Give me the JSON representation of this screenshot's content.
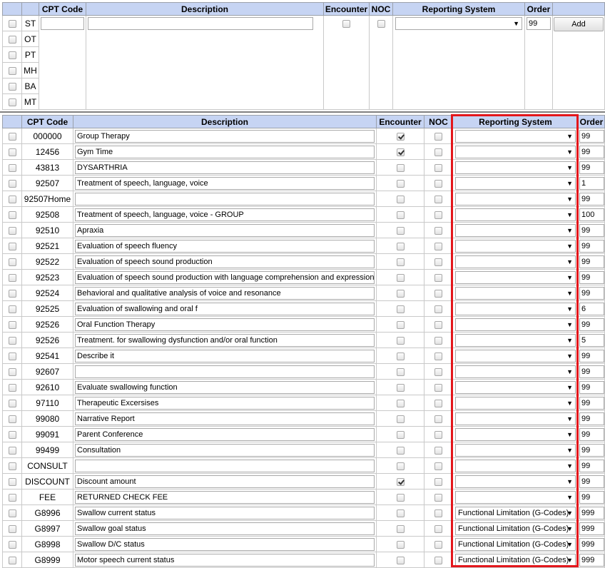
{
  "headers": {
    "cpt_code": "CPT Code",
    "description": "Description",
    "encounter": "Encounter",
    "noc": "NOC",
    "reporting_system": "Reporting System",
    "order": "Order"
  },
  "new_entry": {
    "disciplines": [
      "ST",
      "OT",
      "PT",
      "MH",
      "BA",
      "MT"
    ],
    "cpt_code_value": "",
    "description_value": "",
    "reporting_system_value": "",
    "order_value": "99",
    "add_label": "Add"
  },
  "rows": [
    {
      "code": "000000",
      "description": "Group Therapy",
      "encounter": true,
      "noc": false,
      "reporting": "",
      "order": "99"
    },
    {
      "code": "12456",
      "description": "Gym Time",
      "encounter": true,
      "noc": false,
      "reporting": "",
      "order": "99"
    },
    {
      "code": "43813",
      "description": "DYSARTHRIA",
      "encounter": false,
      "noc": false,
      "reporting": "",
      "order": "99"
    },
    {
      "code": "92507",
      "description": "Treatment of speech, language, voice",
      "encounter": false,
      "noc": false,
      "reporting": "",
      "order": "1"
    },
    {
      "code": "92507Home",
      "description": "",
      "encounter": false,
      "noc": false,
      "reporting": "",
      "order": "99"
    },
    {
      "code": "92508",
      "description": "Treatment of speech, language, voice - GROUP",
      "encounter": false,
      "noc": false,
      "reporting": "",
      "order": "100"
    },
    {
      "code": "92510",
      "description": "Apraxia",
      "encounter": false,
      "noc": false,
      "reporting": "",
      "order": "99"
    },
    {
      "code": "92521",
      "description": "Evaluation of speech fluency",
      "encounter": false,
      "noc": false,
      "reporting": "",
      "order": "99"
    },
    {
      "code": "92522",
      "description": "Evaluation of speech sound production",
      "encounter": false,
      "noc": false,
      "reporting": "",
      "order": "99"
    },
    {
      "code": "92523",
      "description": "Evaluation of speech sound production with language comprehension and expression",
      "encounter": false,
      "noc": false,
      "reporting": "",
      "order": "99"
    },
    {
      "code": "92524",
      "description": "Behavioral and qualitative analysis of voice and resonance",
      "encounter": false,
      "noc": false,
      "reporting": "",
      "order": "99"
    },
    {
      "code": "92525",
      "description": "Evaluation of swallowing and oral f",
      "encounter": false,
      "noc": false,
      "reporting": "",
      "order": "6"
    },
    {
      "code": "92526",
      "description": "Oral Function Therapy",
      "encounter": false,
      "noc": false,
      "reporting": "",
      "order": "99"
    },
    {
      "code": "92526",
      "description": "Treatment. for swallowing dysfunction and/or oral function",
      "encounter": false,
      "noc": false,
      "reporting": "",
      "order": "5"
    },
    {
      "code": "92541",
      "description": "Describe it",
      "encounter": false,
      "noc": false,
      "reporting": "",
      "order": "99"
    },
    {
      "code": "92607",
      "description": "",
      "encounter": false,
      "noc": false,
      "reporting": "",
      "order": "99"
    },
    {
      "code": "92610",
      "description": "Evaluate swallowing function",
      "encounter": false,
      "noc": false,
      "reporting": "",
      "order": "99"
    },
    {
      "code": "97110",
      "description": "Therapeutic Excersises",
      "encounter": false,
      "noc": false,
      "reporting": "",
      "order": "99"
    },
    {
      "code": "99080",
      "description": "Narrative Report",
      "encounter": false,
      "noc": false,
      "reporting": "",
      "order": "99"
    },
    {
      "code": "99091",
      "description": "Parent Conference",
      "encounter": false,
      "noc": false,
      "reporting": "",
      "order": "99"
    },
    {
      "code": "99499",
      "description": "Consultation",
      "encounter": false,
      "noc": false,
      "reporting": "",
      "order": "99"
    },
    {
      "code": "CONSULT",
      "description": "",
      "encounter": false,
      "noc": false,
      "reporting": "",
      "order": "99"
    },
    {
      "code": "DISCOUNT",
      "description": "Discount amount",
      "encounter": true,
      "noc": false,
      "reporting": "",
      "order": "99"
    },
    {
      "code": "FEE",
      "description": "RETURNED CHECK FEE",
      "encounter": false,
      "noc": false,
      "reporting": "",
      "order": "99"
    },
    {
      "code": "G8996",
      "description": "Swallow current status",
      "encounter": false,
      "noc": false,
      "reporting": "Functional Limitation (G-Codes)",
      "order": "999"
    },
    {
      "code": "G8997",
      "description": "Swallow goal status",
      "encounter": false,
      "noc": false,
      "reporting": "Functional Limitation (G-Codes)",
      "order": "999"
    },
    {
      "code": "G8998",
      "description": "Swallow D/C status",
      "encounter": false,
      "noc": false,
      "reporting": "Functional Limitation (G-Codes)",
      "order": "999"
    },
    {
      "code": "G8999",
      "description": "Motor speech current status",
      "encounter": false,
      "noc": false,
      "reporting": "Functional Limitation (G-Codes)",
      "order": "999"
    }
  ],
  "colors": {
    "header_bg": "#c6d4f3",
    "highlight_border": "#e3161b"
  }
}
